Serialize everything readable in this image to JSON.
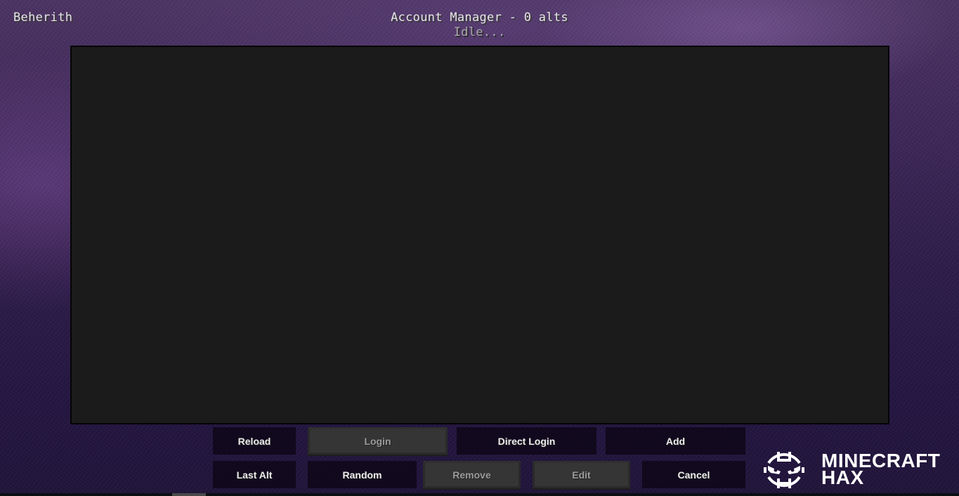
{
  "header": {
    "username": "Beherith",
    "title": "Account Manager - 0 alts",
    "status": "Idle..."
  },
  "alt_list": {
    "count": 0,
    "items": []
  },
  "buttons": {
    "row1": [
      {
        "id": "reload",
        "label": "Reload",
        "enabled": true
      },
      {
        "id": "login",
        "label": "Login",
        "enabled": false
      },
      {
        "id": "direct_login",
        "label": "Direct Login",
        "enabled": true
      },
      {
        "id": "add",
        "label": "Add",
        "enabled": true
      }
    ],
    "row2": [
      {
        "id": "last_alt",
        "label": "Last Alt",
        "enabled": true
      },
      {
        "id": "random",
        "label": "Random",
        "enabled": true
      },
      {
        "id": "remove",
        "label": "Remove",
        "enabled": false
      },
      {
        "id": "edit",
        "label": "Edit",
        "enabled": false
      },
      {
        "id": "cancel",
        "label": "Cancel",
        "enabled": true
      }
    ]
  },
  "watermark": {
    "icon": "minecraft-hax-logo-icon",
    "line1": "MINECRAFT",
    "line2": "HAX"
  },
  "colors": {
    "list_background": "#1b1b1b",
    "button_enabled": "#0e0616",
    "button_disabled": "#353535",
    "text_primary": "#e6e6e6",
    "text_status": "#a8a8a8"
  }
}
